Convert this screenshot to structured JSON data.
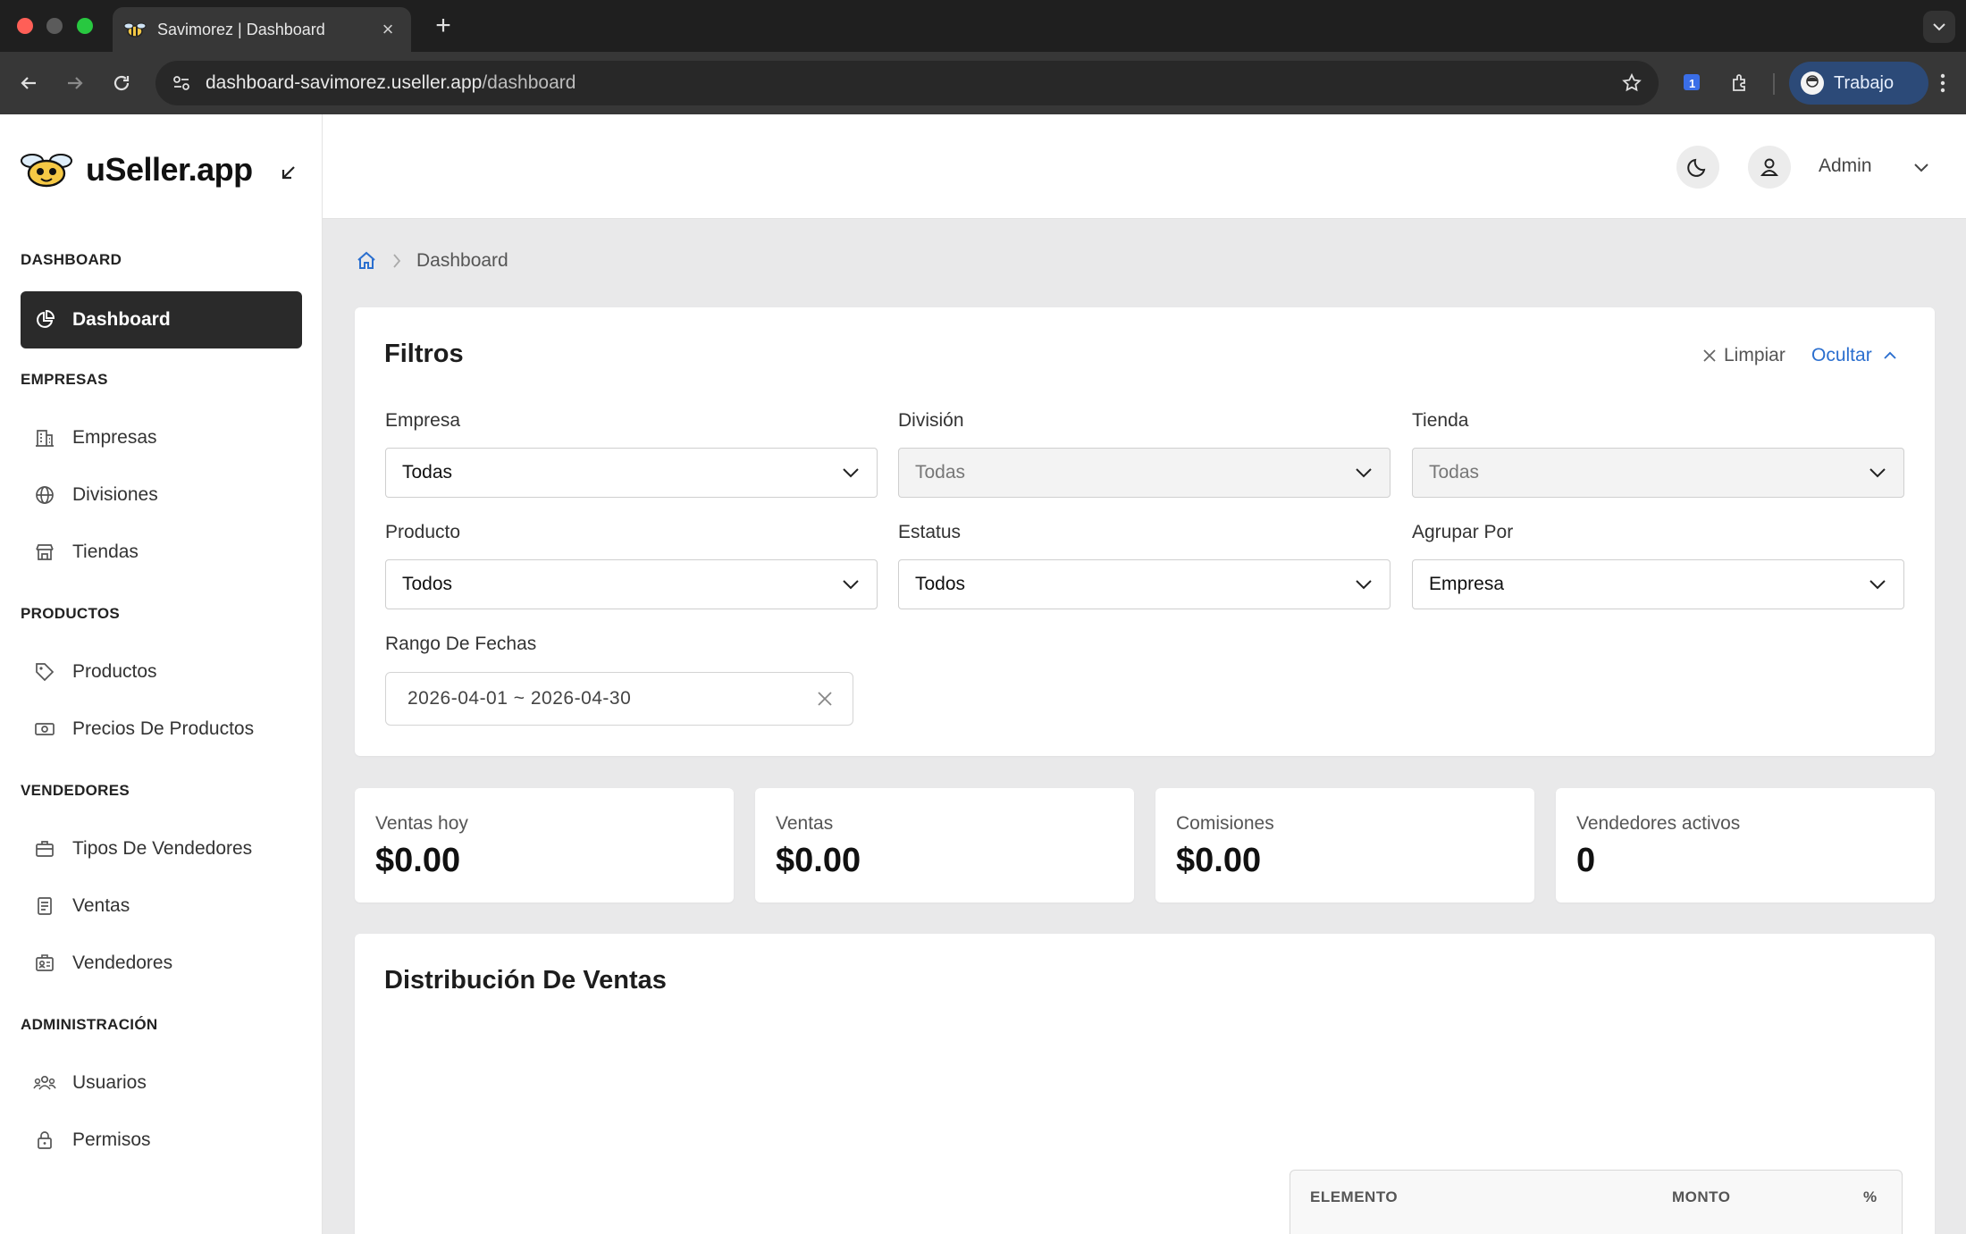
{
  "browser": {
    "tab_title": "Savimorez | Dashboard",
    "url_host": "dashboard-savimorez.useller.app",
    "url_path": "/dashboard",
    "profile_name": "Trabajo"
  },
  "brand": {
    "name": "uSeller.app"
  },
  "header": {
    "user_name": "Admin"
  },
  "sidebar": {
    "sections": [
      {
        "title": "DASHBOARD",
        "items": [
          {
            "label": "Dashboard",
            "icon": "chart-pie-icon",
            "active": true
          }
        ]
      },
      {
        "title": "EMPRESAS",
        "items": [
          {
            "label": "Empresas",
            "icon": "building-icon"
          },
          {
            "label": "Divisiones",
            "icon": "globe-icon"
          },
          {
            "label": "Tiendas",
            "icon": "store-icon"
          }
        ]
      },
      {
        "title": "PRODUCTOS",
        "items": [
          {
            "label": "Productos",
            "icon": "tag-icon"
          },
          {
            "label": "Precios De Productos",
            "icon": "banknote-icon"
          }
        ]
      },
      {
        "title": "VENDEDORES",
        "items": [
          {
            "label": "Tipos De Vendedores",
            "icon": "briefcase-icon"
          },
          {
            "label": "Ventas",
            "icon": "receipt-icon"
          },
          {
            "label": "Vendedores",
            "icon": "id-card-icon"
          }
        ]
      },
      {
        "title": "ADMINISTRACIÓN",
        "items": [
          {
            "label": "Usuarios",
            "icon": "users-icon"
          },
          {
            "label": "Permisos",
            "icon": "lock-icon"
          }
        ]
      }
    ]
  },
  "breadcrumb": {
    "current": "Dashboard"
  },
  "filters": {
    "title": "Filtros",
    "clear_label": "Limpiar",
    "hide_label": "Ocultar",
    "fields": {
      "empresa": {
        "label": "Empresa",
        "value": "Todas"
      },
      "division": {
        "label": "División",
        "value": "Todas"
      },
      "tienda": {
        "label": "Tienda",
        "value": "Todas"
      },
      "producto": {
        "label": "Producto",
        "value": "Todos"
      },
      "estatus": {
        "label": "Estatus",
        "value": "Todos"
      },
      "agrupar": {
        "label": "Agrupar Por",
        "value": "Empresa"
      }
    },
    "date_range": {
      "label": "Rango De Fechas",
      "value": "2026-04-01 ~ 2026-04-30"
    }
  },
  "stats": [
    {
      "label": "Ventas hoy",
      "value": "$0.00"
    },
    {
      "label": "Ventas",
      "value": "$0.00"
    },
    {
      "label": "Comisiones",
      "value": "$0.00"
    },
    {
      "label": "Vendedores activos",
      "value": "0"
    }
  ],
  "distribution": {
    "title": "Distribución De Ventas",
    "columns": [
      "ELEMENTO",
      "MONTO",
      "%"
    ]
  },
  "colors": {
    "accent": "#2b6fcf",
    "active_nav": "#2a2a2a"
  }
}
